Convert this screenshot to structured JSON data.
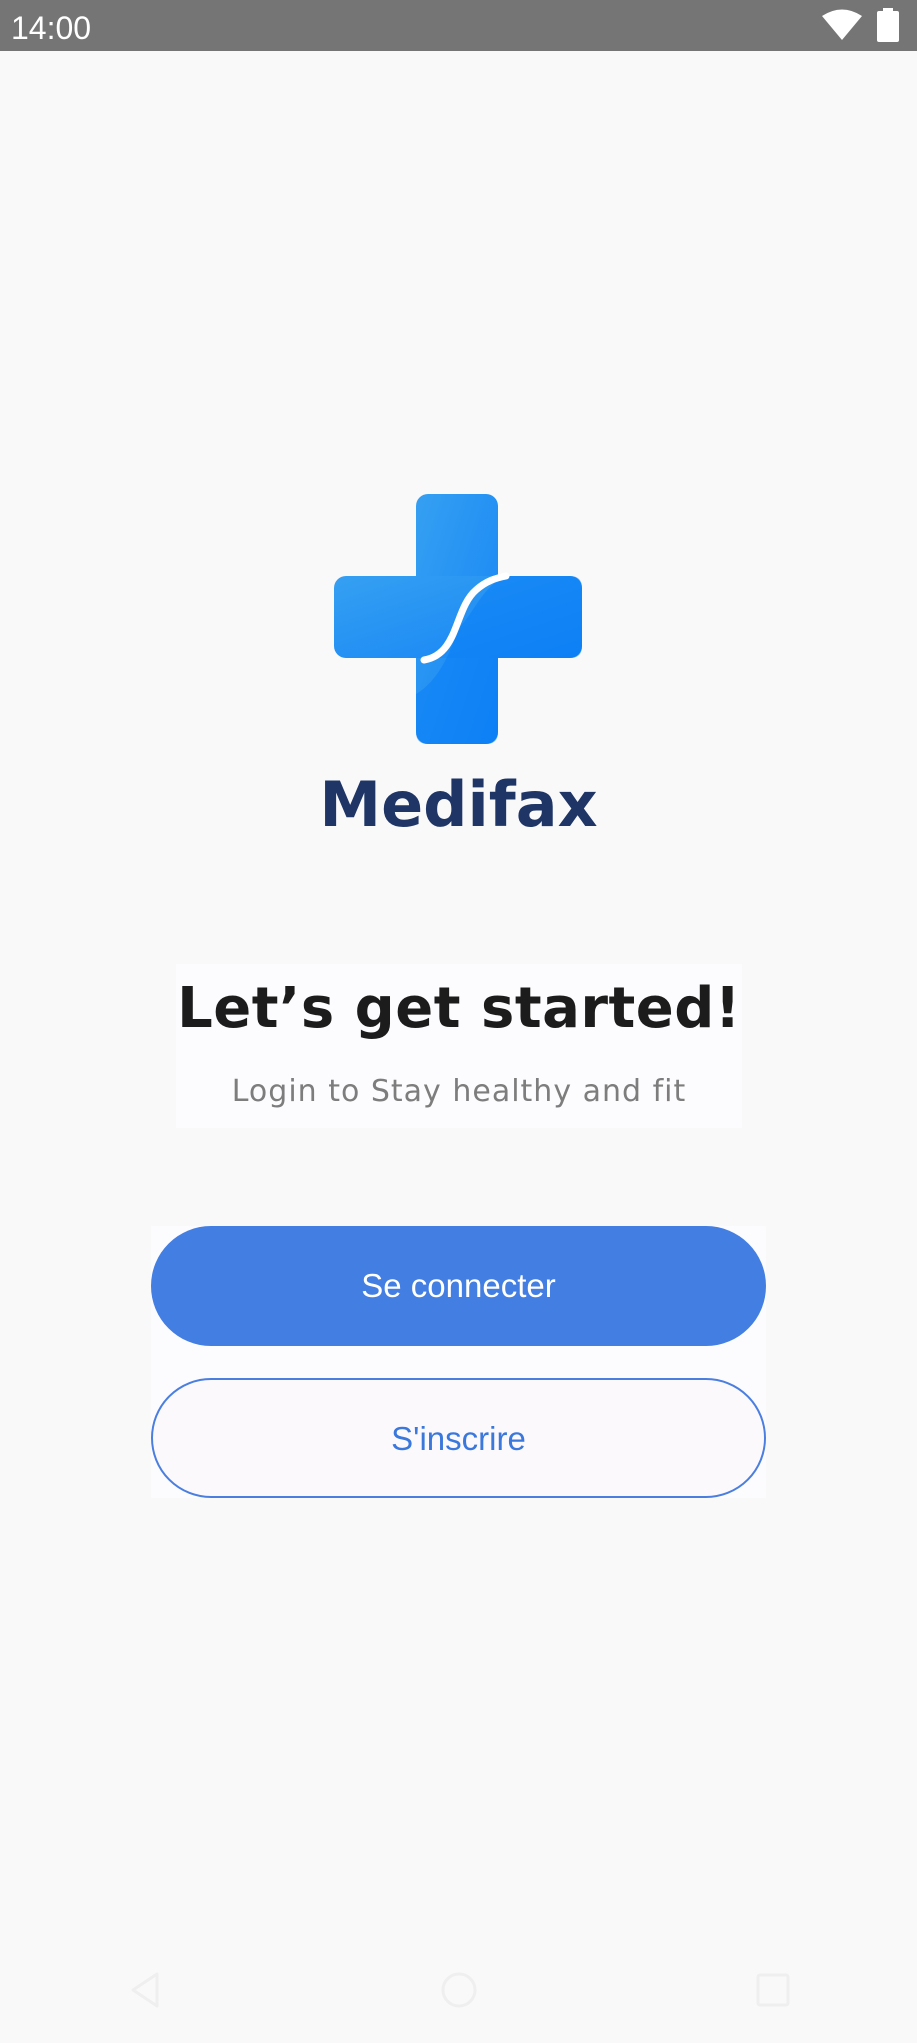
{
  "status_bar": {
    "time": "14:00",
    "icons": [
      "wifi-icon",
      "battery-icon"
    ]
  },
  "app": {
    "name": "Medifax",
    "logo_icon": "medical-cross-icon",
    "logo_colors": [
      "#2d9cf5",
      "#1e88ff"
    ]
  },
  "intro": {
    "headline": "Let’s get started!",
    "subtitle": "Login to Stay healthy and fit"
  },
  "buttons": {
    "login_label": "Se connecter",
    "signup_label": "S'inscrire"
  },
  "nav": {
    "icons": [
      "back-icon",
      "home-icon",
      "recents-icon"
    ]
  },
  "colors": {
    "primary": "#437ee2",
    "brand_text": "#1e3566",
    "status_bar": "#757575"
  }
}
